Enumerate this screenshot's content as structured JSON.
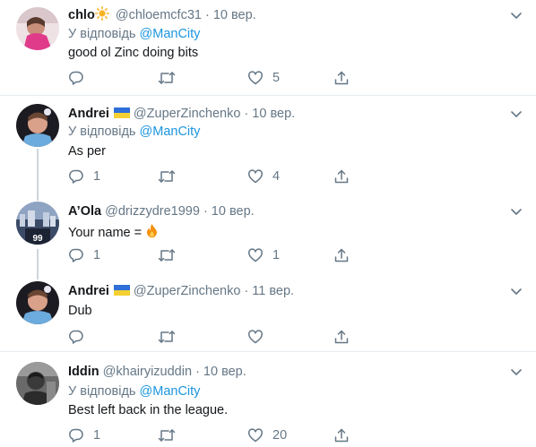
{
  "tweets": [
    {
      "name": "chlo",
      "handle": "@chloemcfc31",
      "date": "· 10 вер.",
      "reply_prefix": "У відповідь",
      "reply_to": "@ManCity",
      "text": "good ol Zinc doing bits",
      "reply_count": "",
      "like_count": "5"
    },
    {
      "name": "Andrei",
      "handle": "@ZuperZinchenko",
      "date": "· 10 вер.",
      "reply_prefix": "У відповідь",
      "reply_to": "@ManCity",
      "text": "As per",
      "reply_count": "1",
      "like_count": "4"
    },
    {
      "name": "A’Ola",
      "handle": "@drizzydre1999",
      "date": "· 10 вер.",
      "text": "Your name =",
      "reply_count": "1",
      "like_count": "1"
    },
    {
      "name": "Andrei",
      "handle": "@ZuperZinchenko",
      "date": "· 11 вер.",
      "text": "Dub",
      "reply_count": "",
      "like_count": ""
    },
    {
      "name": "Iddin",
      "handle": "@khairyizuddin",
      "date": "· 10 вер.",
      "reply_prefix": "У відповідь",
      "reply_to": "@ManCity",
      "text": "Best left back in the league.",
      "reply_count": "1",
      "like_count": "20"
    }
  ],
  "icons": {
    "reply": "reply-icon",
    "retweet": "retweet-icon",
    "like": "heart-icon",
    "share": "share-icon",
    "caret": "chevron-down-icon"
  },
  "colors": {
    "link": "#1b95e0",
    "secondary": "#657786",
    "divider": "#e6ecf0",
    "thread_line": "#ccd6dd"
  }
}
